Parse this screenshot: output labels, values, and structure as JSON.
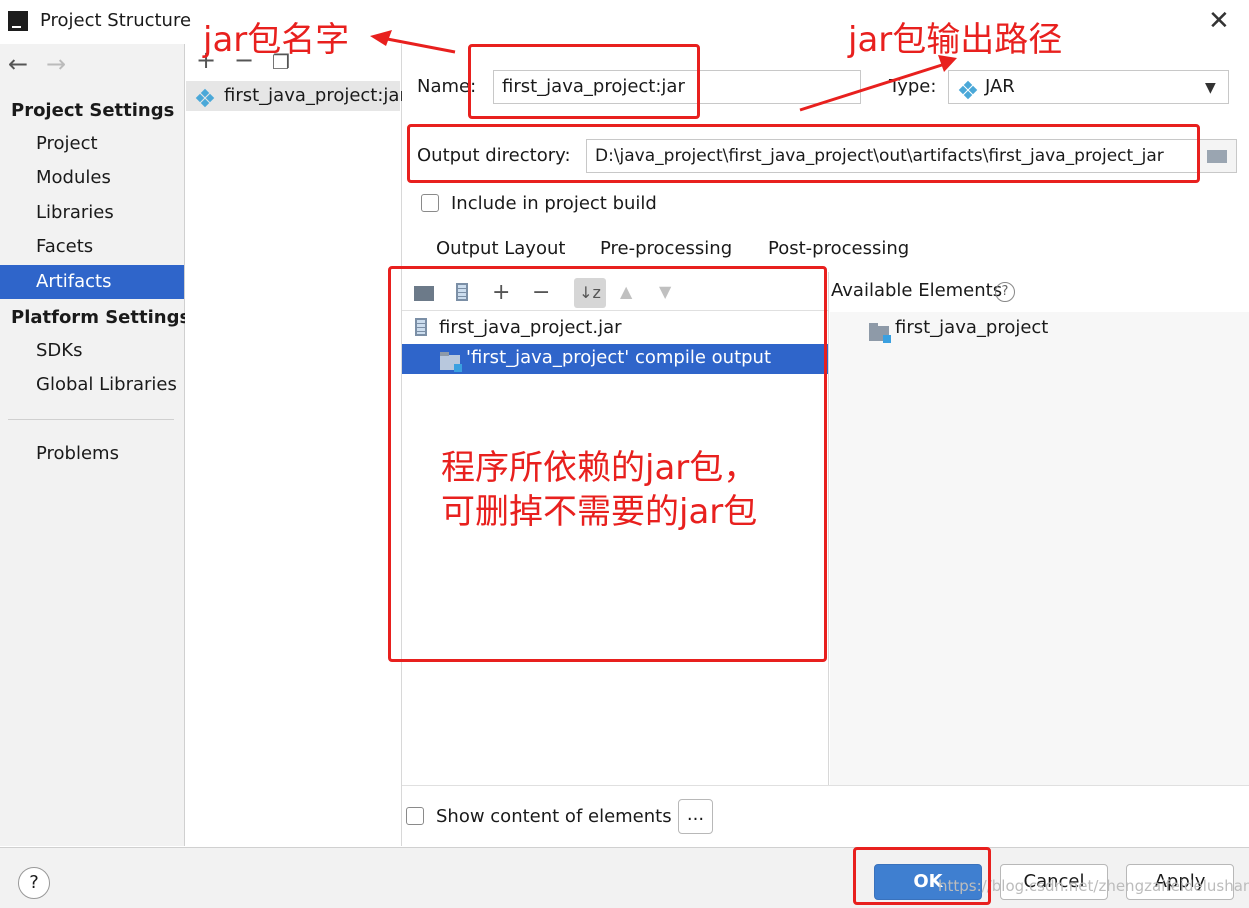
{
  "window": {
    "title": "Project Structure"
  },
  "nav": {
    "project_settings_header": "Project Settings",
    "project_items": [
      "Project",
      "Modules",
      "Libraries",
      "Facets",
      "Artifacts"
    ],
    "selected_item": "Artifacts",
    "platform_settings_header": "Platform Settings",
    "platform_items": [
      "SDKs",
      "Global Libraries"
    ],
    "problems": "Problems"
  },
  "artifact_list": {
    "items": [
      "first_java_project:jar"
    ]
  },
  "config": {
    "name_label": "Name:",
    "name_value": "first_java_project:jar",
    "type_label": "Type:",
    "type_value": "JAR",
    "output_dir_label": "Output directory:",
    "output_dir_value": "D:\\java_project\\first_java_project\\out\\artifacts\\first_java_project_jar",
    "include_build_label": "Include in project build",
    "include_build_checked": false
  },
  "tabs": [
    "Output Layout",
    "Pre-processing",
    "Post-processing"
  ],
  "layout_tree": {
    "root": "first_java_project.jar",
    "child": "'first_java_project' compile output"
  },
  "available": {
    "header": "Available Elements",
    "items": [
      "first_java_project"
    ]
  },
  "show_content": {
    "label": "Show content of elements",
    "dots": "..."
  },
  "footer": {
    "help": "?",
    "ok": "OK",
    "cancel": "Cancel",
    "apply": "Apply"
  },
  "annotations": {
    "jar_name": "jar包名字",
    "jar_output": "jar包输出路径",
    "deps_line1": "程序所依赖的jar包，",
    "deps_line2": "可删掉不需要的jar包"
  },
  "watermark": "https://blog.csdn.net/zhengzaifeidelushang",
  "colors": {
    "accent": "#2f65ca",
    "annotation_red": "#e8201e",
    "ok_button": "#3f7fd0"
  }
}
